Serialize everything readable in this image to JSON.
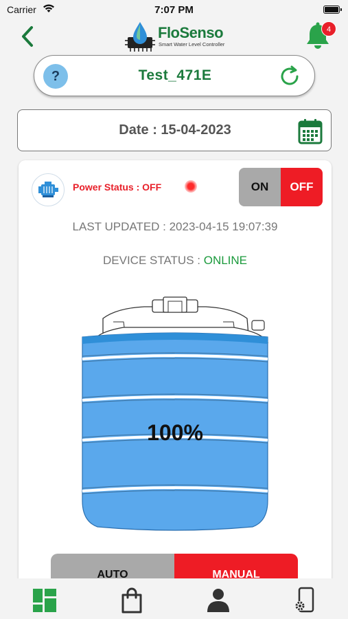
{
  "status_bar": {
    "carrier": "Carrier",
    "time": "7:07 PM"
  },
  "header": {
    "logo_name": "FloSenso",
    "logo_tagline": "Smart Water Level Controller",
    "notification_count": "4"
  },
  "device": {
    "name": "Test_471E",
    "help_symbol": "?"
  },
  "date": {
    "label": "Date : 15-04-2023"
  },
  "card": {
    "power_status": "Power Status : OFF",
    "toggle_on": "ON",
    "toggle_off": "OFF",
    "last_updated": "LAST UPDATED : 2023-04-15 19:07:39",
    "device_status_label": "DEVICE STATUS : ",
    "device_status_value": "ONLINE",
    "tank_level": "100%",
    "tank_level_fraction": 1.0,
    "mode_auto": "AUTO",
    "mode_manual": "MANUAL"
  },
  "tabs": [
    {
      "icon": "dashboard-icon"
    },
    {
      "icon": "shopping-bag-icon"
    },
    {
      "icon": "user-icon"
    },
    {
      "icon": "device-settings-icon"
    }
  ],
  "colors": {
    "brand_green": "#1b7a3c",
    "alert_red": "#ee1c25",
    "water_blue": "#5aa8ec",
    "online_green": "#1b9a3c"
  }
}
